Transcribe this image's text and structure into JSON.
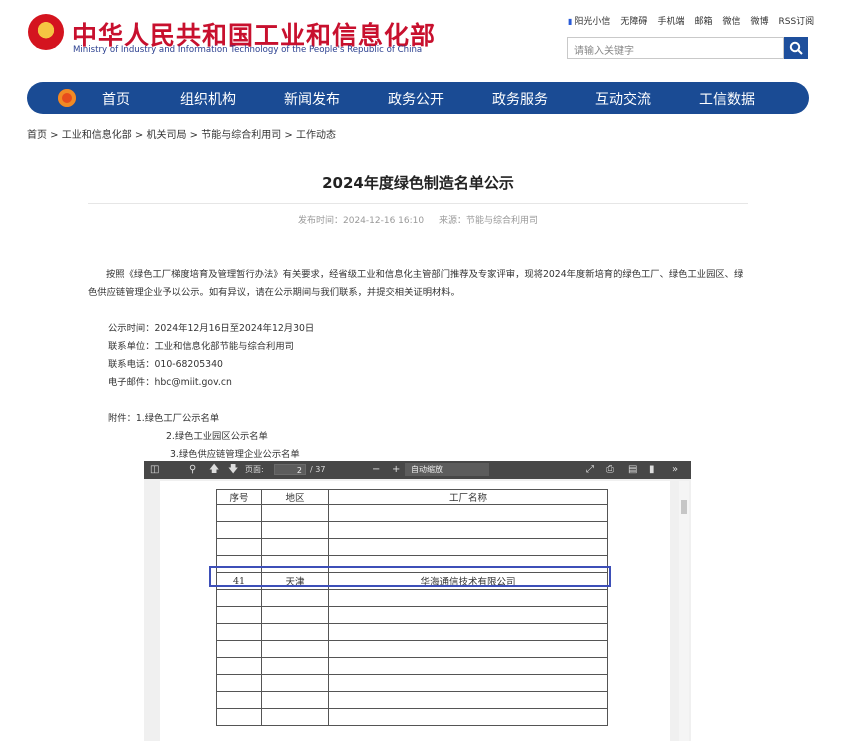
{
  "header": {
    "title": "中华人民共和国工业和信息化部",
    "subtitle": "Ministry of Industry and Information Technology of the People's Republic of China",
    "top_links": [
      "阳光小信",
      "无障碍",
      "手机端",
      "邮箱",
      "微信",
      "微博",
      "RSS订阅"
    ],
    "search_placeholder": "请输入关键字"
  },
  "nav": {
    "items": [
      "首页",
      "组织机构",
      "新闻发布",
      "政务公开",
      "政务服务",
      "互动交流",
      "工信数据"
    ]
  },
  "breadcrumb": "首页 > 工业和信息化部 > 机关司局 > 节能与综合利用司 > 工作动态",
  "article": {
    "title": "2024年度绿色制造名单公示",
    "publish_time": "发布时间：2024-12-16 16:10",
    "source": "来源：节能与综合利用司",
    "body": "按照《绿色工厂梯度培育及管理暂行办法》有关要求，经省级工业和信息化主管部门推荐及专家评审，现将2024年度新培育的绿色工厂、绿色工业园区、绿色供应链管理企业予以公示。如有异议，请在公示期间与我们联系，并提交相关证明材料。",
    "info": [
      "公示时间：2024年12月16日至2024年12月30日",
      "联系单位：工业和信息化部节能与综合利用司",
      "联系电话：010-68205340",
      "电子邮件：hbc@miit.gov.cn"
    ],
    "attachments": [
      "附件：1.绿色工厂公示名单",
      "2.绿色工业园区公示名单",
      "3.绿色供应链管理企业公示名单"
    ]
  },
  "pdf_viewer": {
    "page_label": "页面:",
    "page_current": "2",
    "page_total": "/ 37",
    "zoom": "自动缩放",
    "table": {
      "headers": [
        "序号",
        "地区",
        "工厂名称"
      ],
      "highlight_row": {
        "no": "41",
        "region": "天津",
        "name": "华海通信技术有限公司"
      }
    }
  }
}
